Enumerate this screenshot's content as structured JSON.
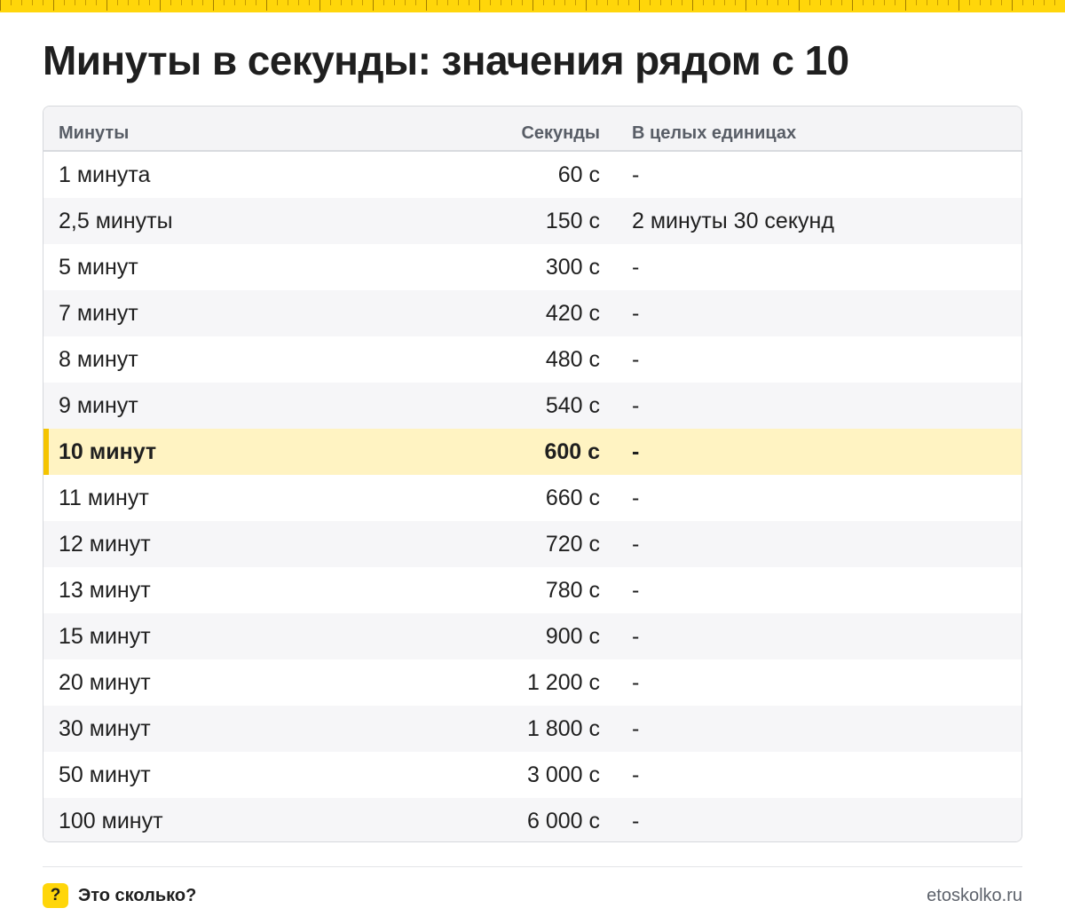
{
  "title": "Минуты в секунды: значения рядом с 10",
  "table": {
    "headers": {
      "minutes": "Минуты",
      "seconds": "Секунды",
      "units": "В целых единицах"
    },
    "rows": [
      {
        "minutes": "1 минута",
        "seconds": "60 с",
        "units": "-"
      },
      {
        "minutes": "2,5 минуты",
        "seconds": "150 с",
        "units": "2 минуты 30 секунд"
      },
      {
        "minutes": "5 минут",
        "seconds": "300 с",
        "units": "-"
      },
      {
        "minutes": "7 минут",
        "seconds": "420 с",
        "units": "-"
      },
      {
        "minutes": "8 минут",
        "seconds": "480 с",
        "units": "-"
      },
      {
        "minutes": "9 минут",
        "seconds": "540 с",
        "units": "-"
      },
      {
        "minutes": "10 минут",
        "seconds": "600 с",
        "units": "-"
      },
      {
        "minutes": "11 минут",
        "seconds": "660 с",
        "units": "-"
      },
      {
        "minutes": "12 минут",
        "seconds": "720 с",
        "units": "-"
      },
      {
        "minutes": "13 минут",
        "seconds": "780 с",
        "units": "-"
      },
      {
        "minutes": "15 минут",
        "seconds": "900 с",
        "units": "-"
      },
      {
        "minutes": "20 минут",
        "seconds": "1 200 с",
        "units": "-"
      },
      {
        "minutes": "30 минут",
        "seconds": "1 800 с",
        "units": "-"
      },
      {
        "minutes": "50 минут",
        "seconds": "3 000 с",
        "units": "-"
      },
      {
        "minutes": "100 минут",
        "seconds": "6 000 с",
        "units": "-"
      }
    ],
    "highlighted_row": 6
  },
  "footer": {
    "icon_glyph": "?",
    "icon_name": "question-mark-icon",
    "brand": "Это сколько?",
    "site": "etoskolko.ru"
  },
  "colors": {
    "accent": "#FFD60A",
    "highlight_row": "#FFF3C2",
    "highlight_bar": "#F5C400"
  }
}
